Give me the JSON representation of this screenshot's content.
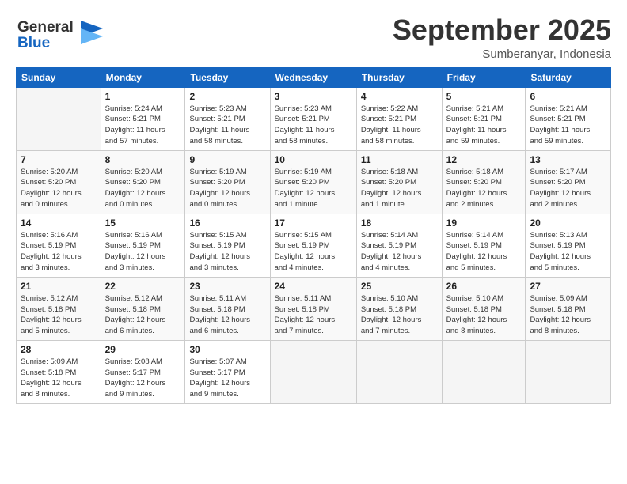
{
  "header": {
    "logo_line1": "General",
    "logo_line2": "Blue",
    "month": "September 2025",
    "location": "Sumberanyar, Indonesia"
  },
  "weekdays": [
    "Sunday",
    "Monday",
    "Tuesday",
    "Wednesday",
    "Thursday",
    "Friday",
    "Saturday"
  ],
  "weeks": [
    [
      {
        "day": "",
        "info": ""
      },
      {
        "day": "1",
        "info": "Sunrise: 5:24 AM\nSunset: 5:21 PM\nDaylight: 11 hours\nand 57 minutes."
      },
      {
        "day": "2",
        "info": "Sunrise: 5:23 AM\nSunset: 5:21 PM\nDaylight: 11 hours\nand 58 minutes."
      },
      {
        "day": "3",
        "info": "Sunrise: 5:23 AM\nSunset: 5:21 PM\nDaylight: 11 hours\nand 58 minutes."
      },
      {
        "day": "4",
        "info": "Sunrise: 5:22 AM\nSunset: 5:21 PM\nDaylight: 11 hours\nand 58 minutes."
      },
      {
        "day": "5",
        "info": "Sunrise: 5:21 AM\nSunset: 5:21 PM\nDaylight: 11 hours\nand 59 minutes."
      },
      {
        "day": "6",
        "info": "Sunrise: 5:21 AM\nSunset: 5:21 PM\nDaylight: 11 hours\nand 59 minutes."
      }
    ],
    [
      {
        "day": "7",
        "info": "Sunrise: 5:20 AM\nSunset: 5:20 PM\nDaylight: 12 hours\nand 0 minutes."
      },
      {
        "day": "8",
        "info": "Sunrise: 5:20 AM\nSunset: 5:20 PM\nDaylight: 12 hours\nand 0 minutes."
      },
      {
        "day": "9",
        "info": "Sunrise: 5:19 AM\nSunset: 5:20 PM\nDaylight: 12 hours\nand 0 minutes."
      },
      {
        "day": "10",
        "info": "Sunrise: 5:19 AM\nSunset: 5:20 PM\nDaylight: 12 hours\nand 1 minute."
      },
      {
        "day": "11",
        "info": "Sunrise: 5:18 AM\nSunset: 5:20 PM\nDaylight: 12 hours\nand 1 minute."
      },
      {
        "day": "12",
        "info": "Sunrise: 5:18 AM\nSunset: 5:20 PM\nDaylight: 12 hours\nand 2 minutes."
      },
      {
        "day": "13",
        "info": "Sunrise: 5:17 AM\nSunset: 5:20 PM\nDaylight: 12 hours\nand 2 minutes."
      }
    ],
    [
      {
        "day": "14",
        "info": "Sunrise: 5:16 AM\nSunset: 5:19 PM\nDaylight: 12 hours\nand 3 minutes."
      },
      {
        "day": "15",
        "info": "Sunrise: 5:16 AM\nSunset: 5:19 PM\nDaylight: 12 hours\nand 3 minutes."
      },
      {
        "day": "16",
        "info": "Sunrise: 5:15 AM\nSunset: 5:19 PM\nDaylight: 12 hours\nand 3 minutes."
      },
      {
        "day": "17",
        "info": "Sunrise: 5:15 AM\nSunset: 5:19 PM\nDaylight: 12 hours\nand 4 minutes."
      },
      {
        "day": "18",
        "info": "Sunrise: 5:14 AM\nSunset: 5:19 PM\nDaylight: 12 hours\nand 4 minutes."
      },
      {
        "day": "19",
        "info": "Sunrise: 5:14 AM\nSunset: 5:19 PM\nDaylight: 12 hours\nand 5 minutes."
      },
      {
        "day": "20",
        "info": "Sunrise: 5:13 AM\nSunset: 5:19 PM\nDaylight: 12 hours\nand 5 minutes."
      }
    ],
    [
      {
        "day": "21",
        "info": "Sunrise: 5:12 AM\nSunset: 5:18 PM\nDaylight: 12 hours\nand 5 minutes."
      },
      {
        "day": "22",
        "info": "Sunrise: 5:12 AM\nSunset: 5:18 PM\nDaylight: 12 hours\nand 6 minutes."
      },
      {
        "day": "23",
        "info": "Sunrise: 5:11 AM\nSunset: 5:18 PM\nDaylight: 12 hours\nand 6 minutes."
      },
      {
        "day": "24",
        "info": "Sunrise: 5:11 AM\nSunset: 5:18 PM\nDaylight: 12 hours\nand 7 minutes."
      },
      {
        "day": "25",
        "info": "Sunrise: 5:10 AM\nSunset: 5:18 PM\nDaylight: 12 hours\nand 7 minutes."
      },
      {
        "day": "26",
        "info": "Sunrise: 5:10 AM\nSunset: 5:18 PM\nDaylight: 12 hours\nand 8 minutes."
      },
      {
        "day": "27",
        "info": "Sunrise: 5:09 AM\nSunset: 5:18 PM\nDaylight: 12 hours\nand 8 minutes."
      }
    ],
    [
      {
        "day": "28",
        "info": "Sunrise: 5:09 AM\nSunset: 5:18 PM\nDaylight: 12 hours\nand 8 minutes."
      },
      {
        "day": "29",
        "info": "Sunrise: 5:08 AM\nSunset: 5:17 PM\nDaylight: 12 hours\nand 9 minutes."
      },
      {
        "day": "30",
        "info": "Sunrise: 5:07 AM\nSunset: 5:17 PM\nDaylight: 12 hours\nand 9 minutes."
      },
      {
        "day": "",
        "info": ""
      },
      {
        "day": "",
        "info": ""
      },
      {
        "day": "",
        "info": ""
      },
      {
        "day": "",
        "info": ""
      }
    ]
  ]
}
